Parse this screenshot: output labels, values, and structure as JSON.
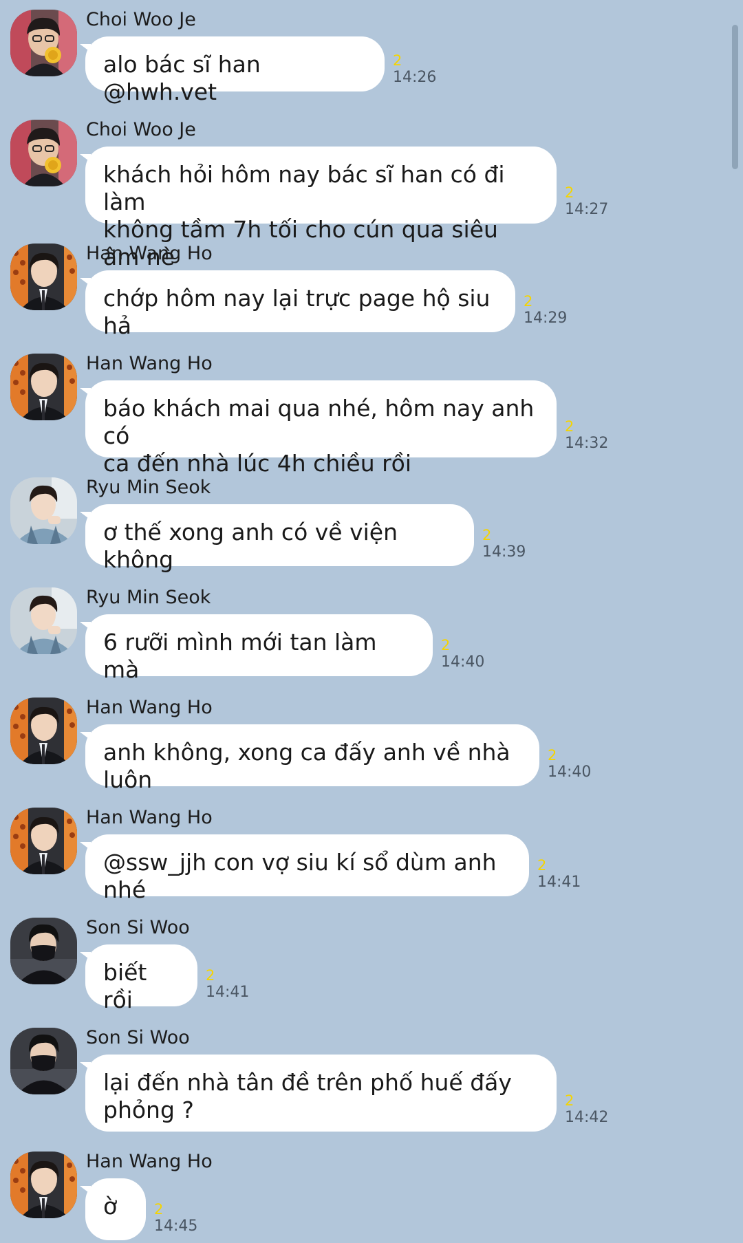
{
  "colors": {
    "background": "#b2c6da",
    "bubble": "#ffffff",
    "unread": "#f5d400",
    "time": "#4a5663"
  },
  "messages": [
    {
      "sender": "Choi Woo Je",
      "avatar": "choi-woo-je-avatar",
      "text": "alo bác sĩ han @hwh.vet",
      "unread": "2",
      "time": "14:26"
    },
    {
      "sender": "Choi Woo Je",
      "avatar": "choi-woo-je-avatar",
      "text": "khách hỏi hôm nay bác sĩ han có đi làm\nkhông tầm 7h tối cho cún qua siêu âm nè",
      "unread": "2",
      "time": "14:27"
    },
    {
      "sender": "Han Wang Ho",
      "avatar": "han-wang-ho-avatar",
      "text": "chớp hôm nay lại trực page hộ siu hả",
      "unread": "2",
      "time": "14:29"
    },
    {
      "sender": "Han Wang Ho",
      "avatar": "han-wang-ho-avatar",
      "text": "báo khách mai qua nhé, hôm nay anh có\nca đến nhà lúc 4h chiều rồi",
      "unread": "2",
      "time": "14:32"
    },
    {
      "sender": "Ryu Min Seok",
      "avatar": "ryu-min-seok-avatar",
      "text": "ơ thế xong anh có về viện không",
      "unread": "2",
      "time": "14:39"
    },
    {
      "sender": "Ryu Min Seok",
      "avatar": "ryu-min-seok-avatar",
      "text": "6 rưỡi mình mới tan làm mà",
      "unread": "2",
      "time": "14:40"
    },
    {
      "sender": "Han Wang Ho",
      "avatar": "han-wang-ho-avatar",
      "text": "anh không, xong ca đấy anh về nhà luôn",
      "unread": "2",
      "time": "14:40"
    },
    {
      "sender": "Han Wang Ho",
      "avatar": "han-wang-ho-avatar",
      "text": "@ssw_jjh con vợ siu kí sổ dùm anh nhé",
      "unread": "2",
      "time": "14:41"
    },
    {
      "sender": "Son Si Woo",
      "avatar": "son-si-woo-avatar",
      "text": "biết rồi",
      "unread": "2",
      "time": "14:41"
    },
    {
      "sender": "Son Si Woo",
      "avatar": "son-si-woo-avatar",
      "text": "lại đến nhà tân đề trên phố huế đấy\nphỏng ?",
      "unread": "2",
      "time": "14:42"
    },
    {
      "sender": "Han Wang Ho",
      "avatar": "han-wang-ho-avatar",
      "text": "ờ",
      "unread": "2",
      "time": "14:45"
    }
  ]
}
